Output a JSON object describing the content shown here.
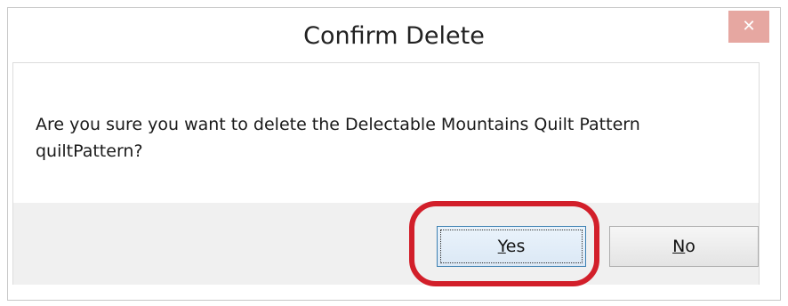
{
  "window": {
    "title": "Confirm Delete",
    "close_glyph": "✕"
  },
  "message": {
    "line1": "Are you sure you want to delete the Delectable Mountains Quilt Pattern",
    "line2": "quiltPattern?"
  },
  "buttons": {
    "yes": {
      "mnemonic": "Y",
      "rest": "es"
    },
    "no": {
      "mnemonic": "N",
      "rest": "o"
    }
  },
  "colors": {
    "close_button": "#e6a7a1",
    "highlight": "#d21f2a",
    "button_bar": "#f0f0f0"
  }
}
